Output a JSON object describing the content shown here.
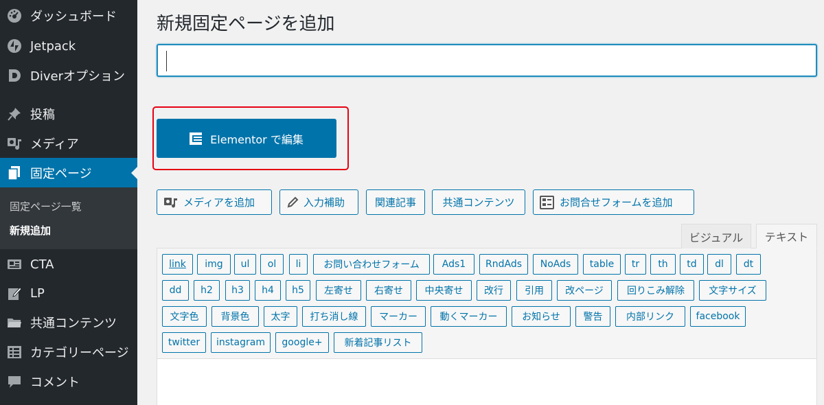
{
  "sidebar": {
    "items": [
      {
        "label": "ダッシュボード",
        "icon": "dashboard-icon"
      },
      {
        "label": "Jetpack",
        "icon": "jetpack-icon"
      },
      {
        "label": "Diverオプション",
        "icon": "diver-icon"
      },
      {
        "label": "投稿",
        "icon": "pin-icon"
      },
      {
        "label": "メディア",
        "icon": "media-icon"
      },
      {
        "label": "固定ページ",
        "icon": "pages-icon"
      },
      {
        "label": "CTA",
        "icon": "cta-icon"
      },
      {
        "label": "LP",
        "icon": "edit-page-icon"
      },
      {
        "label": "共通コンテンツ",
        "icon": "folder-icon"
      },
      {
        "label": "カテゴリーページ",
        "icon": "category-icon"
      },
      {
        "label": "コメント",
        "icon": "comment-icon"
      }
    ],
    "submenu": [
      "固定ページ一覧",
      "新規追加"
    ]
  },
  "main": {
    "title": "新規固定ページを追加",
    "title_input_value": "",
    "elementor_button": "Elementor で編集",
    "toolbar": [
      "メディアを追加",
      "入力補助",
      "関連記事",
      "共通コンテンツ",
      "お問合せフォームを追加"
    ],
    "tabs": [
      "ビジュアル",
      "テキスト"
    ],
    "quicktags": [
      [
        "link",
        "img",
        "ul",
        "ol",
        "li",
        "お問い合わせフォーム",
        "Ads1",
        "RndAds",
        "NoAds",
        "table",
        "tr",
        "th",
        "td",
        "dl",
        "dt"
      ],
      [
        "dd",
        "h2",
        "h3",
        "h4",
        "h5",
        "左寄せ",
        "右寄せ",
        "中央寄せ",
        "改行",
        "引用",
        "改ページ",
        "回りこみ解除",
        "文字サイズ"
      ],
      [
        "文字色",
        "背景色",
        "太字",
        "打ち消し線",
        "マーカー",
        "動くマーカー",
        "お知らせ",
        "警告",
        "内部リンク",
        "facebook"
      ],
      [
        "twitter",
        "instagram",
        "google+",
        "新着記事リスト"
      ]
    ]
  },
  "colors": {
    "sidebar_bg": "#23282d",
    "accent": "#0073aa",
    "highlight_frame": "#e60012"
  }
}
